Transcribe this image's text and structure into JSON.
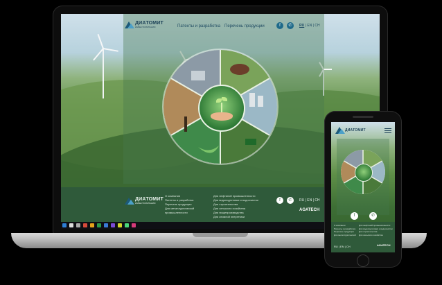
{
  "brand": {
    "name": "ДИАТОМИТ",
    "subtitle": "ИНВЕСТКОМПАНИЯ"
  },
  "nav": {
    "items": [
      "Патенты и разработка",
      "Перечень продукции"
    ]
  },
  "header": {
    "social": [
      "f",
      "✆"
    ],
    "languages": {
      "active": "RU",
      "others": "| EN | CH"
    }
  },
  "footer": {
    "col1": [
      "О компании",
      "Патенты и разработка",
      "Перечень продукции",
      "Для металлургической",
      "промышленности"
    ],
    "col2": [
      "Для нефтяной промышленности",
      "Для водоподготовки и водоочистки",
      "Для строительства",
      "Для сельского хозяйства",
      "Для пищепрoизводства",
      "Для атомной энергетики"
    ],
    "languages": "RU | EN | CH",
    "partner": "AGATECH"
  },
  "phone": {
    "languages": "RU | EN | CH",
    "partner": "AGATECH"
  },
  "colors": {
    "brand_blue": "#1d5a7a",
    "footer_green": "#2f5a3a",
    "accent_green": "#4e8a3c"
  },
  "icons": {
    "facebook": "facebook-icon",
    "phone": "phone-icon",
    "menu": "hamburger-menu-icon"
  }
}
